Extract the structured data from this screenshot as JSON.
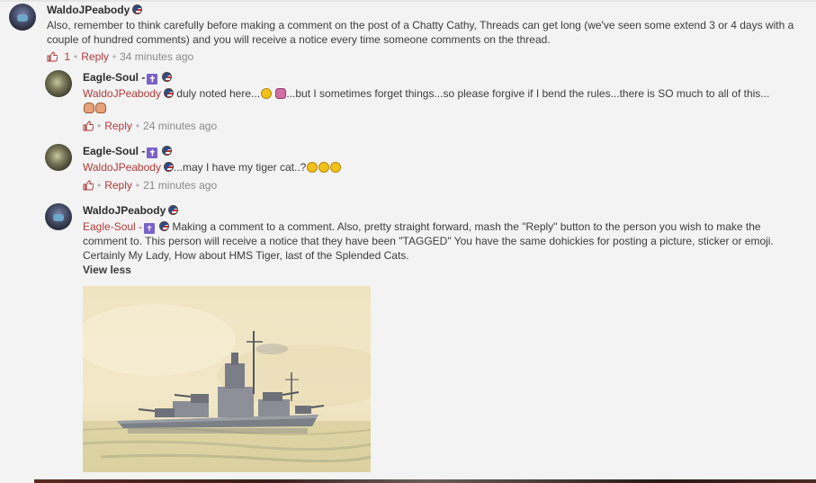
{
  "comments": [
    {
      "author": "WaldoJPeabody",
      "text": "Also, remember to think carefully before making a comment on the post of a Chatty Cathy, Threads can get long (we've seen some extend 3 or 4 days with a couple of hundred comments) and you will receive a notice every time someone comments on the thread.",
      "likes": "1",
      "reply_label": "Reply",
      "time": "34 minutes ago"
    },
    {
      "author": "Eagle-Soul -",
      "mention": "WaldoJPeabody",
      "text_a": "duly noted here...",
      "text_b": "...but I sometimes forget things...so please forgive if I bend the rules...there is SO much to all of this...",
      "reply_label": "Reply",
      "time": "24 minutes ago"
    },
    {
      "author": "Eagle-Soul -",
      "mention": "WaldoJPeabody",
      "text": "...may I have my tiger cat..?",
      "reply_label": "Reply",
      "time": "21 minutes ago"
    },
    {
      "author": "WaldoJPeabody",
      "mention": "Eagle-Soul -",
      "text_a": "Making a comment to a comment. Also, pretty straight forward, mash the \"Reply\" button to the person you wish to make the comment to. This person will receive a notice that they have been \"TAGGED\" You have the same dohickies for posting a picture, sticker or emoji.",
      "text_b": "Certainly My Lady, How about HMS Tiger, last of the Splended Cats.",
      "view_less": "View less"
    }
  ],
  "icons": {
    "flag": "us-flag-icon",
    "cross": "cross-icon",
    "like": "thumbs-up-icon"
  },
  "colors": {
    "mention": "#b03a3a",
    "reply": "#b03a3a",
    "meta": "#8a8a8a"
  }
}
